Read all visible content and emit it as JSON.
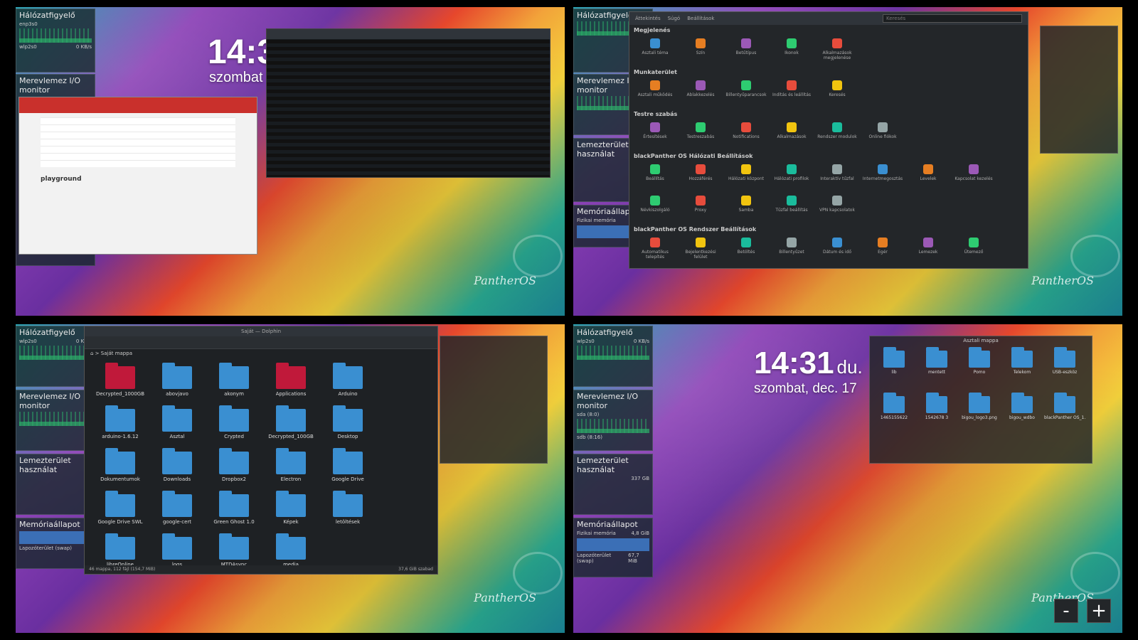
{
  "widgets": {
    "network_title": "Hálózatfigyelő",
    "enp3s0": "enp3s0",
    "wlp2s0": "wlp2s0",
    "wlp_value": "0 KB/s",
    "disk_title": "Merevlemez I/O monitor",
    "sda": "sda (8:0)",
    "sdb": "sdb (8:16)",
    "space_title": "Lemezterület használat",
    "space_value": "337 GB",
    "mem_title": "Memóriaállapot",
    "mem_phys": "Fizikai memória",
    "mem_phys_value": "4,8 GiB",
    "mem_swap": "Lapozóterület (swap)",
    "mem_swap_value": "67,7 MiB"
  },
  "clock": {
    "time": "14:31",
    "ampm": "du.",
    "date": "szombat, dec. 17",
    "date_short": "szombat"
  },
  "browser": {
    "heading": "playground"
  },
  "settings": {
    "search_placeholder": "Keresés",
    "back": "Áttekintés",
    "help": "Súgó",
    "configure": "Beállítások",
    "sections": [
      {
        "title": "Megjelenés",
        "items": [
          "Asztali téma",
          "Szín",
          "Betűtípus",
          "Ikonok",
          "Alkalmazások megjelenése"
        ]
      },
      {
        "title": "Munkaterület",
        "items": [
          "Asztali működés",
          "Ablakkezelés",
          "Billentyűparancsok",
          "Indítás és leállítás",
          "Keresés"
        ]
      },
      {
        "title": "Testre szabás",
        "items": [
          "Értesítések",
          "Testreszabás",
          "Notifications",
          "Alkalmazások",
          "Rendszer modulok",
          "Online fiókok"
        ]
      },
      {
        "title": "blackPanther OS Hálózati Beállítások",
        "items": [
          "Beállítás",
          "Hozzáférés",
          "Hálózati központ",
          "Hálózati profilok",
          "Interaktív tűzfal",
          "Internetmegosztás",
          "Levelek",
          "Kapcsolat kezelés",
          "Névkiszolgáló",
          "Proxy",
          "Samba",
          "Tűzfal beállítás",
          "VPN kapcsolatok"
        ]
      },
      {
        "title": "blackPanther OS Rendszer Beállítások",
        "items": [
          "Automatikus telepítés",
          "Bejelentkezési felület",
          "Betöltés",
          "Billentyűzet",
          "Dátum és idő",
          "Egér",
          "Lemezek",
          "Ütemező"
        ]
      }
    ]
  },
  "filemanager": {
    "title": "Saját — Dolphin",
    "breadcrumb": "Saját mappa",
    "status": "46 mappa, 112 fájl (154,7 MiB)",
    "free": "37,6 GiB szabad",
    "folders": [
      {
        "name": "Decrypted_1000GB",
        "red": true
      },
      {
        "name": "abovjavo",
        "red": false
      },
      {
        "name": "akonym",
        "red": false
      },
      {
        "name": "Applications",
        "red": true
      },
      {
        "name": "Arduino",
        "red": false
      },
      {
        "name": "arduino-1.6.12",
        "red": false
      },
      {
        "name": "Asztal",
        "red": false
      },
      {
        "name": "Crypted",
        "red": false
      },
      {
        "name": "Decrypted_100GB",
        "red": false
      },
      {
        "name": "Desktop",
        "red": false
      },
      {
        "name": "Dokumentumok",
        "red": false
      },
      {
        "name": "Downloads",
        "red": false
      },
      {
        "name": "Dropbox2",
        "red": false
      },
      {
        "name": "Electron",
        "red": false
      },
      {
        "name": "Google Drive",
        "red": false
      },
      {
        "name": "Google Drive SWL",
        "red": false
      },
      {
        "name": "google-cert",
        "red": false
      },
      {
        "name": "Green Ghost 1.0",
        "red": false
      },
      {
        "name": "Képek",
        "red": false
      },
      {
        "name": "letöltések",
        "red": false
      },
      {
        "name": "libreOnline",
        "red": false
      },
      {
        "name": "logs",
        "red": false
      },
      {
        "name": "MTDAsync",
        "red": false
      },
      {
        "name": "media",
        "red": false
      }
    ]
  },
  "folderview": {
    "title": "Asztali mappa",
    "items": [
      "lib",
      "mentett",
      "Pomo",
      "Telekom",
      "USB-eszköz",
      "1465155622",
      "1542678 3",
      "bigou_logo3.png",
      "bigou_wdbo",
      "blackPanther OS_1.pdf"
    ]
  },
  "zoom": {
    "minus": "-",
    "plus": "+"
  },
  "logo": "PantherOS"
}
